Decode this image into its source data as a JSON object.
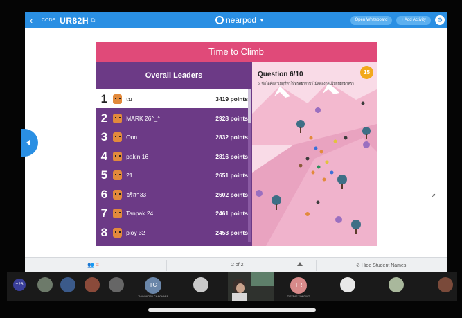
{
  "topbar": {
    "code_label": "CODE:",
    "code_value": "UR82H",
    "brand": "nearpod",
    "open_whiteboard": "Open Whiteboard",
    "add_activity": "+ Add Activity"
  },
  "activity": {
    "title": "Time to Climb",
    "leaders_title": "Overall Leaders",
    "leaders": [
      {
        "rank": "1",
        "name": "เม",
        "points": "3419 points"
      },
      {
        "rank": "2",
        "name": "MARK 26^_^",
        "points": "2928 points"
      },
      {
        "rank": "3",
        "name": "Oon",
        "points": "2832 points"
      },
      {
        "rank": "4",
        "name": "pakin 16",
        "points": "2816 points"
      },
      {
        "rank": "5",
        "name": "21",
        "points": "2651 points"
      },
      {
        "rank": "6",
        "name": "อริสา33",
        "points": "2602 points"
      },
      {
        "rank": "7",
        "name": "Tanpak 24",
        "points": "2461 points"
      },
      {
        "rank": "8",
        "name": "ploy 32",
        "points": "2453 points"
      }
    ],
    "question_header": "Question 6/10",
    "question_text": "6. ข้อใดคือสาเหตุที่ทำให้ทรัพยากรป่าไม้ลดลงกลับไปกับผกผาศรร",
    "timer": "15"
  },
  "footer": {
    "page": "2 of 2",
    "hide_names": "Hide Student Names"
  },
  "participants": {
    "more": "+26",
    "tiles": [
      {
        "initials": "TC",
        "label": "THANAKORN CHAICHANA"
      },
      {
        "initials": "TR",
        "label": "TISYBAE YONGYAT"
      }
    ]
  },
  "colors": {
    "nearpod_blue": "#2a8fe3",
    "banner_pink": "#e04a79",
    "leaders_purple": "#6c3a86",
    "timer_orange": "#f2a91c"
  }
}
